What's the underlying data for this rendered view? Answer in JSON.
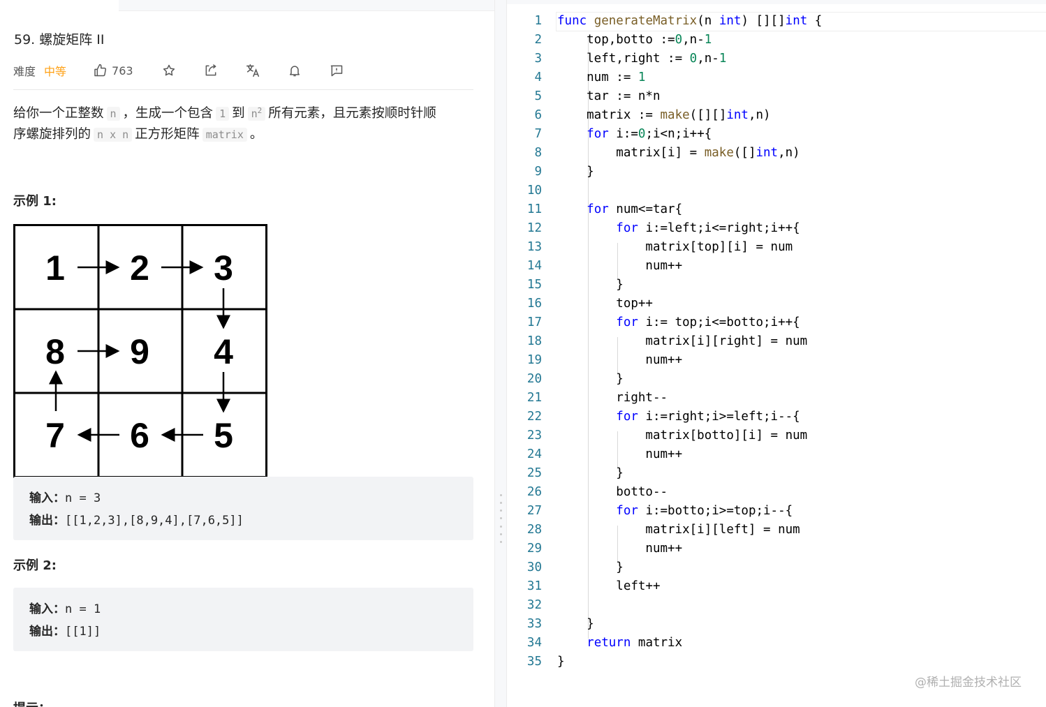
{
  "problem": {
    "title": "59. 螺旋矩阵 II",
    "difficulty_label": "难度",
    "difficulty_value": "中等",
    "likes": "763",
    "description": {
      "p1": "给你一个正整数",
      "var_n": "n",
      "p2": "，生成一个包含",
      "one": "1",
      "p3": "到",
      "n_sq_base": "n",
      "n_sq_exp": "2",
      "p4": "所有元素，且元素按顺时针顺",
      "p5": "序螺旋排列的",
      "nxn": "n x n",
      "p6": "正方形矩阵",
      "matrix": "matrix",
      "p7": "。"
    },
    "examples": [
      {
        "heading": "示例 1:",
        "input_label": "输入：",
        "input_value": "n = 3",
        "output_label": "输出：",
        "output_value": "[[1,2,3],[8,9,4],[7,6,5]]"
      },
      {
        "heading": "示例 2:",
        "input_label": "输入：",
        "input_value": "n = 1",
        "output_label": "输出：",
        "output_value": "[[1]]"
      }
    ],
    "grid": [
      [
        "1",
        "2",
        "3"
      ],
      [
        "8",
        "9",
        "4"
      ],
      [
        "7",
        "6",
        "5"
      ]
    ],
    "hint_heading": "提示："
  },
  "icons": [
    "thumbs-up-icon",
    "star-icon",
    "share-icon",
    "translate-icon",
    "bell-icon",
    "feedback-icon"
  ],
  "colors": {
    "difficulty": "#ffa116",
    "keyword": "#0000ff",
    "number": "#098658",
    "function": "#795e26",
    "line_number": "#237893"
  },
  "editor": {
    "lines": [
      [
        [
          "kw",
          "func"
        ],
        [
          "t",
          " "
        ],
        [
          "fn",
          "generateMatrix"
        ],
        [
          "t",
          "(n "
        ],
        [
          "kw",
          "int"
        ],
        [
          "t",
          ") [][]"
        ],
        [
          "kw",
          "int"
        ],
        [
          "t",
          " {"
        ]
      ],
      [
        [
          "t",
          "    top,botto :="
        ],
        [
          "num",
          "0"
        ],
        [
          "t",
          ",n-"
        ],
        [
          "num",
          "1"
        ]
      ],
      [
        [
          "t",
          "    left,right := "
        ],
        [
          "num",
          "0"
        ],
        [
          "t",
          ",n-"
        ],
        [
          "num",
          "1"
        ]
      ],
      [
        [
          "t",
          "    num := "
        ],
        [
          "num",
          "1"
        ]
      ],
      [
        [
          "t",
          "    tar := n*n"
        ]
      ],
      [
        [
          "t",
          "    matrix := "
        ],
        [
          "fn",
          "make"
        ],
        [
          "t",
          "([][]"
        ],
        [
          "kw",
          "int"
        ],
        [
          "t",
          ",n)"
        ]
      ],
      [
        [
          "t",
          "    "
        ],
        [
          "kw",
          "for"
        ],
        [
          "t",
          " i:="
        ],
        [
          "num",
          "0"
        ],
        [
          "t",
          ";i<n;i++{"
        ]
      ],
      [
        [
          "t",
          "        matrix[i] = "
        ],
        [
          "fn",
          "make"
        ],
        [
          "t",
          "([]"
        ],
        [
          "kw",
          "int"
        ],
        [
          "t",
          ",n)"
        ]
      ],
      [
        [
          "t",
          "    }"
        ]
      ],
      [
        [
          "t",
          ""
        ]
      ],
      [
        [
          "t",
          "    "
        ],
        [
          "kw",
          "for"
        ],
        [
          "t",
          " num<=tar{"
        ]
      ],
      [
        [
          "t",
          "        "
        ],
        [
          "kw",
          "for"
        ],
        [
          "t",
          " i:=left;i<=right;i++{"
        ]
      ],
      [
        [
          "t",
          "            matrix[top][i] = num"
        ]
      ],
      [
        [
          "t",
          "            num++"
        ]
      ],
      [
        [
          "t",
          "        }"
        ]
      ],
      [
        [
          "t",
          "        top++"
        ]
      ],
      [
        [
          "t",
          "        "
        ],
        [
          "kw",
          "for"
        ],
        [
          "t",
          " i:= top;i<=botto;i++{"
        ]
      ],
      [
        [
          "t",
          "            matrix[i][right] = num"
        ]
      ],
      [
        [
          "t",
          "            num++"
        ]
      ],
      [
        [
          "t",
          "        }"
        ]
      ],
      [
        [
          "t",
          "        right--"
        ]
      ],
      [
        [
          "t",
          "        "
        ],
        [
          "kw",
          "for"
        ],
        [
          "t",
          " i:=right;i>=left;i--{"
        ]
      ],
      [
        [
          "t",
          "            matrix[botto][i] = num"
        ]
      ],
      [
        [
          "t",
          "            num++"
        ]
      ],
      [
        [
          "t",
          "        }"
        ]
      ],
      [
        [
          "t",
          "        botto--"
        ]
      ],
      [
        [
          "t",
          "        "
        ],
        [
          "kw",
          "for"
        ],
        [
          "t",
          " i:=botto;i>=top;i--{"
        ]
      ],
      [
        [
          "t",
          "            matrix[i][left] = num"
        ]
      ],
      [
        [
          "t",
          "            num++"
        ]
      ],
      [
        [
          "t",
          "        }"
        ]
      ],
      [
        [
          "t",
          "        left++"
        ]
      ],
      [
        [
          "t",
          ""
        ]
      ],
      [
        [
          "t",
          "    }"
        ]
      ],
      [
        [
          "t",
          "    "
        ],
        [
          "kw",
          "return"
        ],
        [
          "t",
          " matrix"
        ]
      ],
      [
        [
          "t",
          "}"
        ]
      ]
    ]
  },
  "watermark": "@稀土掘金技术社区"
}
